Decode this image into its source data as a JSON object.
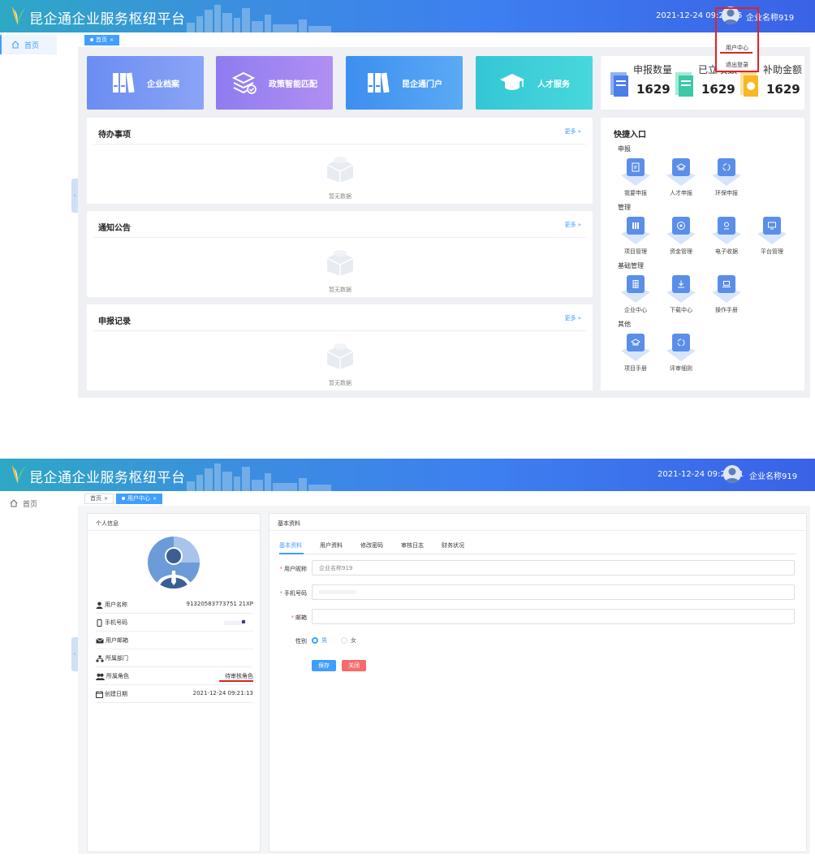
{
  "app": {
    "title": "昆企通企业服务枢纽平台",
    "company_name": "企业名称919"
  },
  "shot1": {
    "clock": "2021-12-24 09:28:06",
    "sidebar": {
      "home": "首页"
    },
    "breadcrumb": {
      "home": "首页"
    },
    "tiles": [
      {
        "label": "企业档案",
        "color": "#6d8ff3"
      },
      {
        "label": "政策智能匹配",
        "color": "#9b7cf0"
      },
      {
        "label": "昆企通门户",
        "color": "#4a9df2"
      },
      {
        "label": "人才服务",
        "color": "#3ecfd6"
      }
    ],
    "stats": [
      {
        "label": "申报数量",
        "value": "1629"
      },
      {
        "label": "已立项数",
        "value": "1629"
      },
      {
        "label": "补助金额",
        "value": "1629"
      }
    ],
    "panels": [
      {
        "title": "待办事项",
        "more": "更多",
        "empty": "暂无数据"
      },
      {
        "title": "通知公告",
        "more": "更多",
        "empty": "暂无数据"
      },
      {
        "title": "申报记录",
        "more": "更多",
        "empty": "暂无数据"
      }
    ],
    "quick_entry": {
      "title": "快捷入口",
      "groups": [
        {
          "name": "申报",
          "items": [
            "我要申报",
            "人才申报",
            "环保申报"
          ]
        },
        {
          "name": "管理",
          "items": [
            "项目管理",
            "资金管理",
            "电子收据",
            "平台管理"
          ]
        },
        {
          "name": "基础管理",
          "items": [
            "企业中心",
            "下载中心",
            "操作手册"
          ]
        },
        {
          "name": "其他",
          "items": [
            "项目手册",
            "评审细则"
          ]
        }
      ]
    },
    "dropdown": {
      "user_center": "用户中心",
      "logout": "退出登录"
    }
  },
  "shot2": {
    "clock": "2021-12-24 09:29:41",
    "sidebar": {
      "home": "首页"
    },
    "breadcrumb": {
      "home": "首页",
      "current": "用户中心"
    },
    "personal": {
      "title": "个人信息",
      "rows": [
        {
          "key": "用户名称",
          "value": "91320583773751 21XP"
        },
        {
          "key": "手机号码",
          "value": ""
        },
        {
          "key": "用户邮箱",
          "value": ""
        },
        {
          "key": "所属部门",
          "value": ""
        },
        {
          "key": "所属角色",
          "value": "待审核角色"
        },
        {
          "key": "创建日期",
          "value": "2021-12-24 09:21:13"
        }
      ]
    },
    "basic": {
      "title": "基本资料",
      "tabs": [
        "基本资料",
        "用户资料",
        "修改密码",
        "审核日志",
        "财务状况"
      ],
      "fields": {
        "nickname_label": "用户昵称",
        "nickname_value": "企业名称919",
        "phone_label": "手机号码",
        "email_label": "邮箱",
        "gender_label": "性别",
        "male": "男",
        "female": "女"
      },
      "buttons": {
        "save": "保存",
        "close": "关闭"
      }
    }
  },
  "colors": {
    "primary": "#409eff",
    "danger": "#f56c6c",
    "annotation": "#e02424"
  }
}
